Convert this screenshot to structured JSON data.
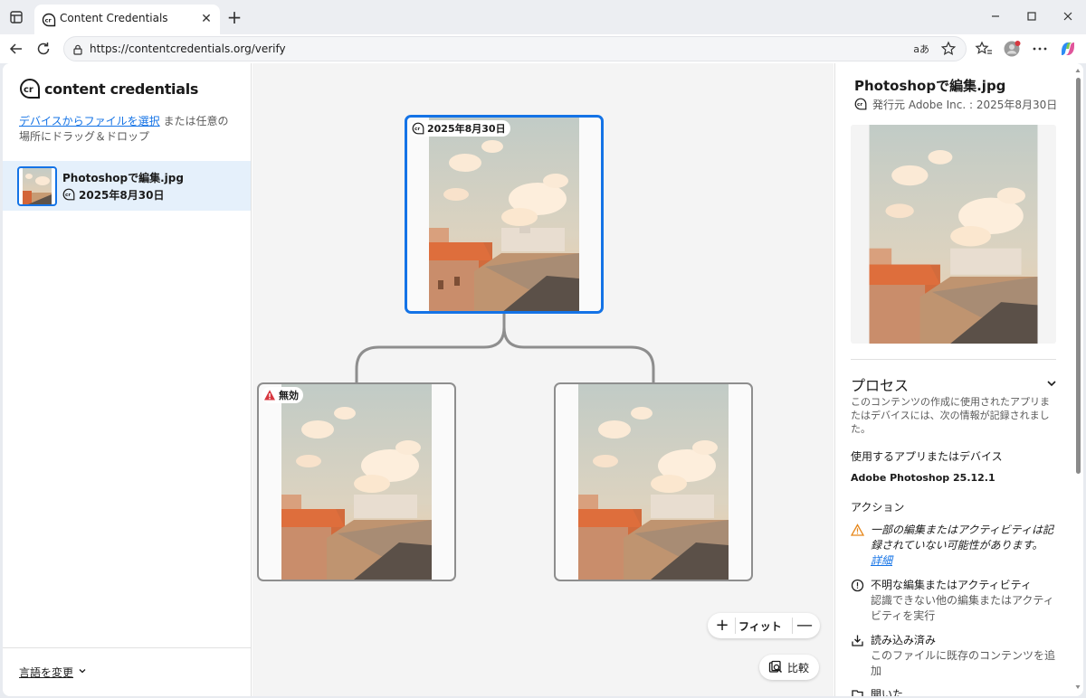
{
  "browser": {
    "tab_title": "Content Credentials",
    "url": "https://contentcredentials.org/verify",
    "read_aloud": "aあ"
  },
  "sidebar": {
    "logo_text": "content credentials",
    "drop_link": "デバイスからファイルを選択",
    "drop_rest": " または任意の場所にドラッグ＆ドロップ",
    "file": {
      "name": "Photoshopで編集.jpg",
      "date": "2025年8月30日"
    },
    "language": "言語を変更"
  },
  "canvas": {
    "root_badge": "2025年8月30日",
    "left_badge": "無効",
    "zoom_in": "+",
    "fit": "フィット",
    "zoom_out": "—",
    "compare": "比較"
  },
  "details": {
    "title": "Photoshopで編集.jpg",
    "issuer": "発行元 Adobe Inc. : 2025年8月30日",
    "process_heading": "プロセス",
    "process_desc": "このコンテンツの作成に使用されたアプリまたはデバイスには、次の情報が記録されました。",
    "app_heading": "使用するアプリまたはデバイス",
    "app_value": "Adobe Photoshop 25.12.1",
    "actions_heading": "アクション",
    "warning_text": "一部の編集またはアクティビティは記録されていない可能性があります。",
    "warning_link": "詳細",
    "unknown_title": "不明な編集またはアクティビティ",
    "unknown_desc": "認識できない他の編集またはアクティビティを実行",
    "imported_title": "読み込み済み",
    "imported_desc": "このファイルに既存のコンテンツを追加",
    "opened_title": "開いた"
  },
  "colors": {
    "accent": "#1473e6",
    "warning": "#e68619",
    "invalid": "#d7373f"
  }
}
